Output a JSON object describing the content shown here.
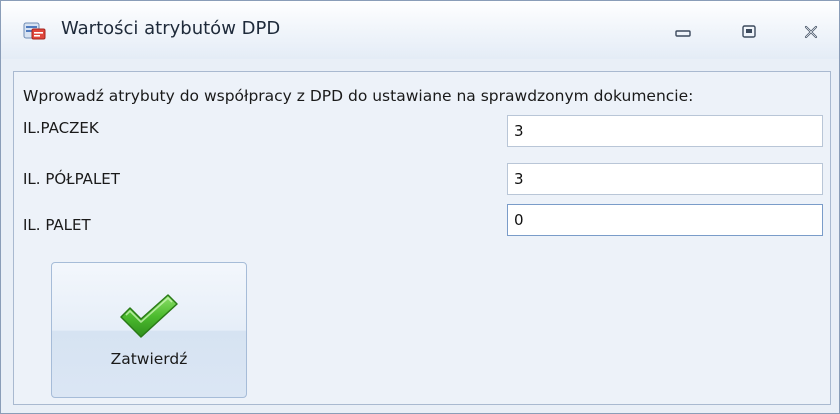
{
  "window": {
    "title": "Wartości atrybutów DPD",
    "icon": "dialog-app-icon"
  },
  "controls": {
    "minimize_icon": "minimize-icon",
    "maximize_icon": "maximize-icon",
    "close_icon": "close-icon"
  },
  "form": {
    "intro": "Wprowadź atrybuty do współpracy z DPD do ustawiane na sprawdzonym dokumencie:",
    "fields": [
      {
        "label": "IL.PACZEK",
        "value": "3"
      },
      {
        "label": "IL. PÓŁPALET",
        "value": "3"
      },
      {
        "label": "IL. PALET",
        "value": "0"
      }
    ]
  },
  "confirm": {
    "label": "Zatwierdź",
    "icon": "checkmark-icon",
    "icon_color": "#3fae29"
  },
  "colors": {
    "background": "#edf2f9",
    "border": "#a9b9d0",
    "button_border": "#a6bcd8"
  }
}
